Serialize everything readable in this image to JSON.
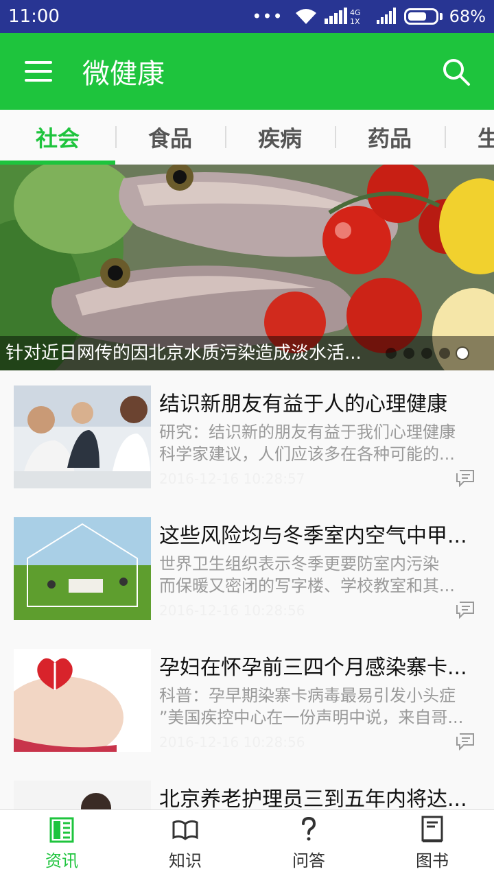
{
  "status_bar": {
    "time": "11:00",
    "dots": "•••",
    "network": "4G 1X",
    "battery": "68%"
  },
  "app_bar": {
    "title": "微健康"
  },
  "tabs": [
    {
      "label": "社会",
      "active": true
    },
    {
      "label": "食品",
      "active": false
    },
    {
      "label": "疾病",
      "active": false
    },
    {
      "label": "药品",
      "active": false
    },
    {
      "label": "生",
      "active": false
    }
  ],
  "banner": {
    "caption": "针对近日网传的因北京水质污染造成淡水活...",
    "page_count": 5,
    "active_index": 4
  },
  "news": [
    {
      "title": "结识新朋友有益于人的心理健康",
      "summary_line1": "研究：结识新的朋友有益于我们心理健康",
      "summary_line2": "科学家建议，人们应该多在各种可能的...",
      "time": "2016-12-16 10:28:57"
    },
    {
      "title": "这些风险均与冬季室内空气中甲...",
      "summary_line1": "世界卫生组织表示冬季更要防室内污染",
      "summary_line2": "而保暖又密闭的写字楼、学校教室和其...",
      "time": "2016-12-16 10:28:56"
    },
    {
      "title": "孕妇在怀孕前三四个月感染寨卡...",
      "summary_line1": "科普：孕早期染寨卡病毒最易引发小头症",
      "summary_line2": "”美国疾控中心在一份声明中说，来自哥...",
      "time": "2016-12-16 10:28:56"
    },
    {
      "title": "北京养老护理员三到五年内将达...",
      "summary_line1": "",
      "summary_line2": "",
      "time": ""
    }
  ],
  "bottom_nav": [
    {
      "label": "资讯",
      "icon": "news-icon",
      "active": true
    },
    {
      "label": "知识",
      "icon": "book-open-icon",
      "active": false
    },
    {
      "label": "问答",
      "icon": "question-icon",
      "active": false
    },
    {
      "label": "图书",
      "icon": "book-icon",
      "active": false
    }
  ],
  "colors": {
    "primary": "#1ec43d",
    "status_bar": "#283593"
  }
}
